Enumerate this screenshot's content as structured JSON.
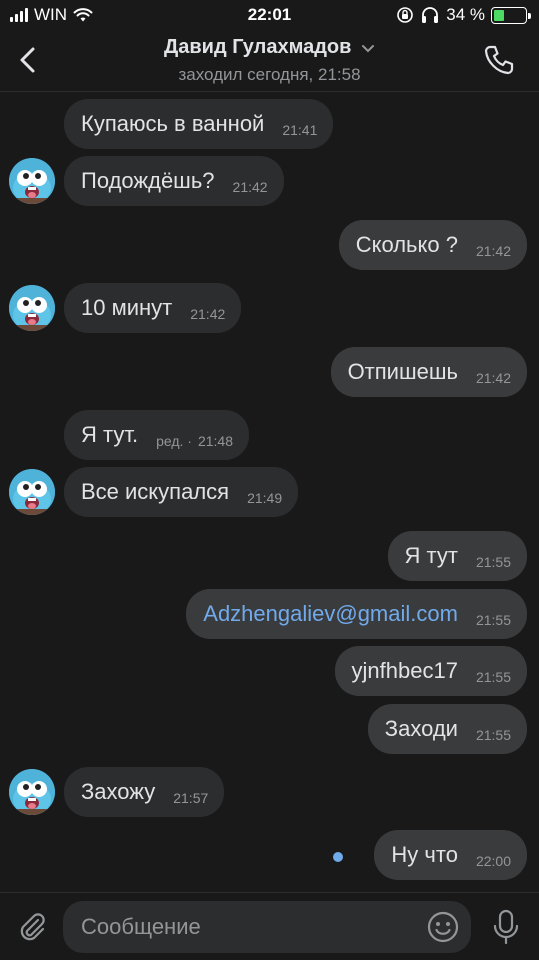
{
  "status_bar": {
    "carrier": "WIN",
    "time": "22:01",
    "battery_percent": "34 %",
    "battery_level": 0.34
  },
  "header": {
    "name": "Давид Гулахмадов",
    "status": "заходил сегодня, 21:58",
    "back_icon": "chevron-left-icon",
    "call_icon": "phone-icon"
  },
  "messages": [
    {
      "dir": "in",
      "text": "Купаюсь в ванной",
      "time": "21:41",
      "avatar": false
    },
    {
      "dir": "in",
      "text": "Подождёшь?",
      "time": "21:42",
      "avatar": true
    },
    {
      "dir": "out",
      "text": "Сколько ?",
      "time": "21:42"
    },
    {
      "dir": "in",
      "text": "10 минут",
      "time": "21:42",
      "avatar": true
    },
    {
      "dir": "out",
      "text": "Отпишешь",
      "time": "21:42"
    },
    {
      "dir": "in",
      "text": "Я тут.",
      "edited": "ред. ·",
      "time": "21:48",
      "avatar": false
    },
    {
      "dir": "in",
      "text": "Все искупался",
      "time": "21:49",
      "avatar": true
    },
    {
      "dir": "out",
      "text": "Я тут",
      "time": "21:55"
    },
    {
      "dir": "out",
      "text": "Adzhengaliev@gmail.com",
      "time": "21:55",
      "link": true
    },
    {
      "dir": "out",
      "text": "yjnfhbec17",
      "time": "21:55"
    },
    {
      "dir": "out",
      "text": "Заходи",
      "time": "21:55"
    },
    {
      "dir": "in",
      "text": "Захожу",
      "time": "21:57",
      "avatar": true
    },
    {
      "dir": "out",
      "text": "Ну что",
      "time": "22:00",
      "unread": true
    }
  ],
  "composer": {
    "placeholder": "Сообщение",
    "attach_icon": "paperclip-icon",
    "emoji_icon": "emoji-icon",
    "mic_icon": "microphone-icon"
  },
  "colors": {
    "background": "#19191a",
    "incoming_bubble": "#2c2d2e",
    "outgoing_bubble": "#3a3b3d",
    "link": "#71aaeb",
    "secondary_text": "#939699"
  }
}
